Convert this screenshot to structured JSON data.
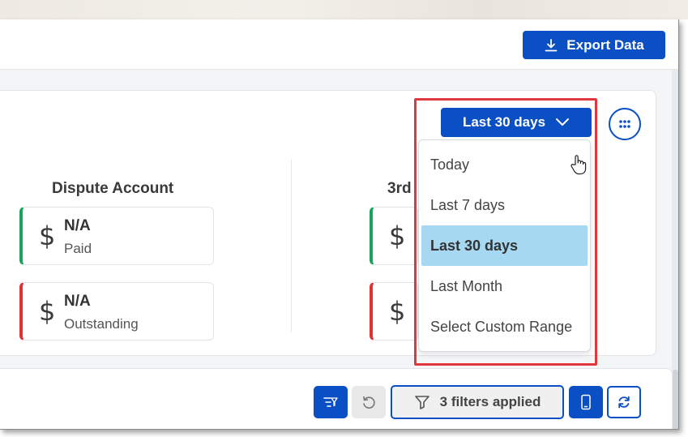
{
  "header": {
    "export_label": "Export Data"
  },
  "summary": {
    "range_label": "Last 30 days",
    "columns": [
      {
        "title": "Dispute Account",
        "cards": [
          {
            "value": "N/A",
            "label": "Paid",
            "status": "paid",
            "color": "#1aa35c"
          },
          {
            "value": "N/A",
            "label": "Outstanding",
            "status": "outstanding",
            "color": "#e03333"
          }
        ]
      },
      {
        "title": "3rd",
        "cards": [
          {
            "value": "",
            "label": "",
            "status": "paid",
            "color": "#1aa35c"
          },
          {
            "value": "",
            "label": "",
            "status": "outstanding",
            "color": "#e03333"
          }
        ]
      }
    ],
    "currency_symbol": "$"
  },
  "dropdown": {
    "options": [
      "Today",
      "Last 7 days",
      "Last 30 days",
      "Last Month",
      "Select Custom Range"
    ],
    "selected": "Last 30 days"
  },
  "toolbar": {
    "filters_label": "3 filters applied"
  },
  "colors": {
    "primary": "#0a4fc4",
    "selected_option": "#a7d8f2",
    "annotation": "#e0383e"
  },
  "icons": [
    "download-icon",
    "chevron-down-icon",
    "grid-dots-icon",
    "filter-list-icon",
    "undo-icon",
    "filter-icon",
    "mobile-icon",
    "refresh-icon",
    "hand-cursor-icon"
  ]
}
